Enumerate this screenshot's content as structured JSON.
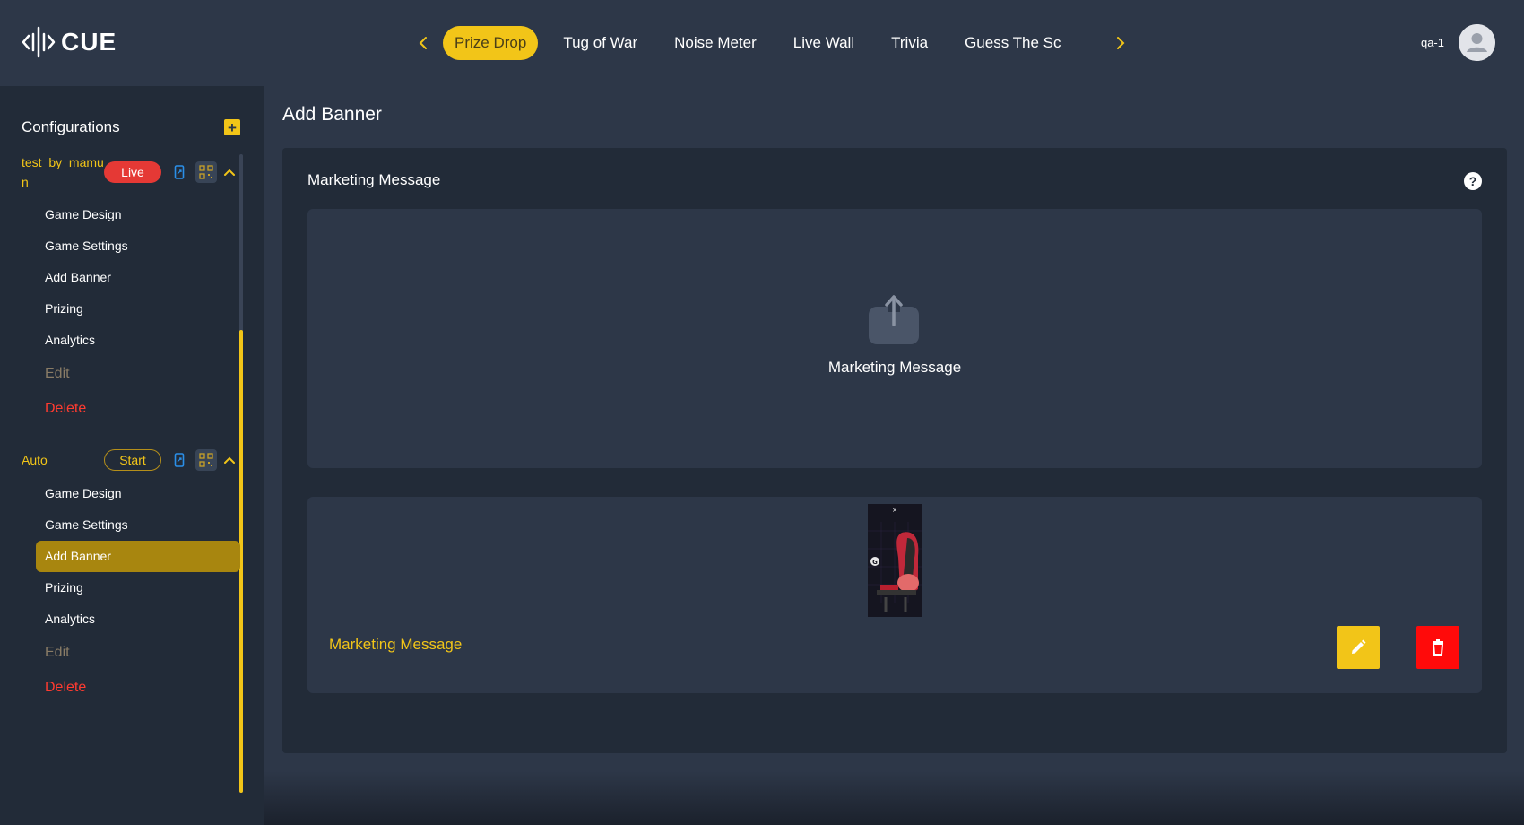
{
  "app": {
    "logo_text": "CUE",
    "user_name": "qa-1"
  },
  "colors": {
    "accent": "#f2c518",
    "live": "#e53935",
    "delete": "#ff0a0a",
    "bg": "#2d3748",
    "panel": "#222b38"
  },
  "game_nav": {
    "tabs": [
      {
        "label": "Prize Drop",
        "active": true
      },
      {
        "label": "Tug of War",
        "active": false
      },
      {
        "label": "Noise Meter",
        "active": false
      },
      {
        "label": "Live Wall",
        "active": false
      },
      {
        "label": "Trivia",
        "active": false
      },
      {
        "label": "Guess The Sc",
        "active": false
      }
    ]
  },
  "sidebar": {
    "title": "Configurations",
    "configs": [
      {
        "name": "test_by_mamun",
        "status": "Live",
        "menu": [
          "Game Design",
          "Game Settings",
          "Add Banner",
          "Prizing",
          "Analytics"
        ],
        "edit": "Edit",
        "delete": "Delete"
      },
      {
        "name": "Auto",
        "status": "Start",
        "menu": [
          "Game Design",
          "Game Settings",
          "Add Banner",
          "Prizing",
          "Analytics"
        ],
        "active_item": "Add Banner",
        "edit": "Edit",
        "delete": "Delete"
      }
    ]
  },
  "main": {
    "page_title": "Add Banner",
    "section_title": "Marketing Message",
    "upload_label": "Marketing Message",
    "banner_label": "Marketing Message"
  }
}
